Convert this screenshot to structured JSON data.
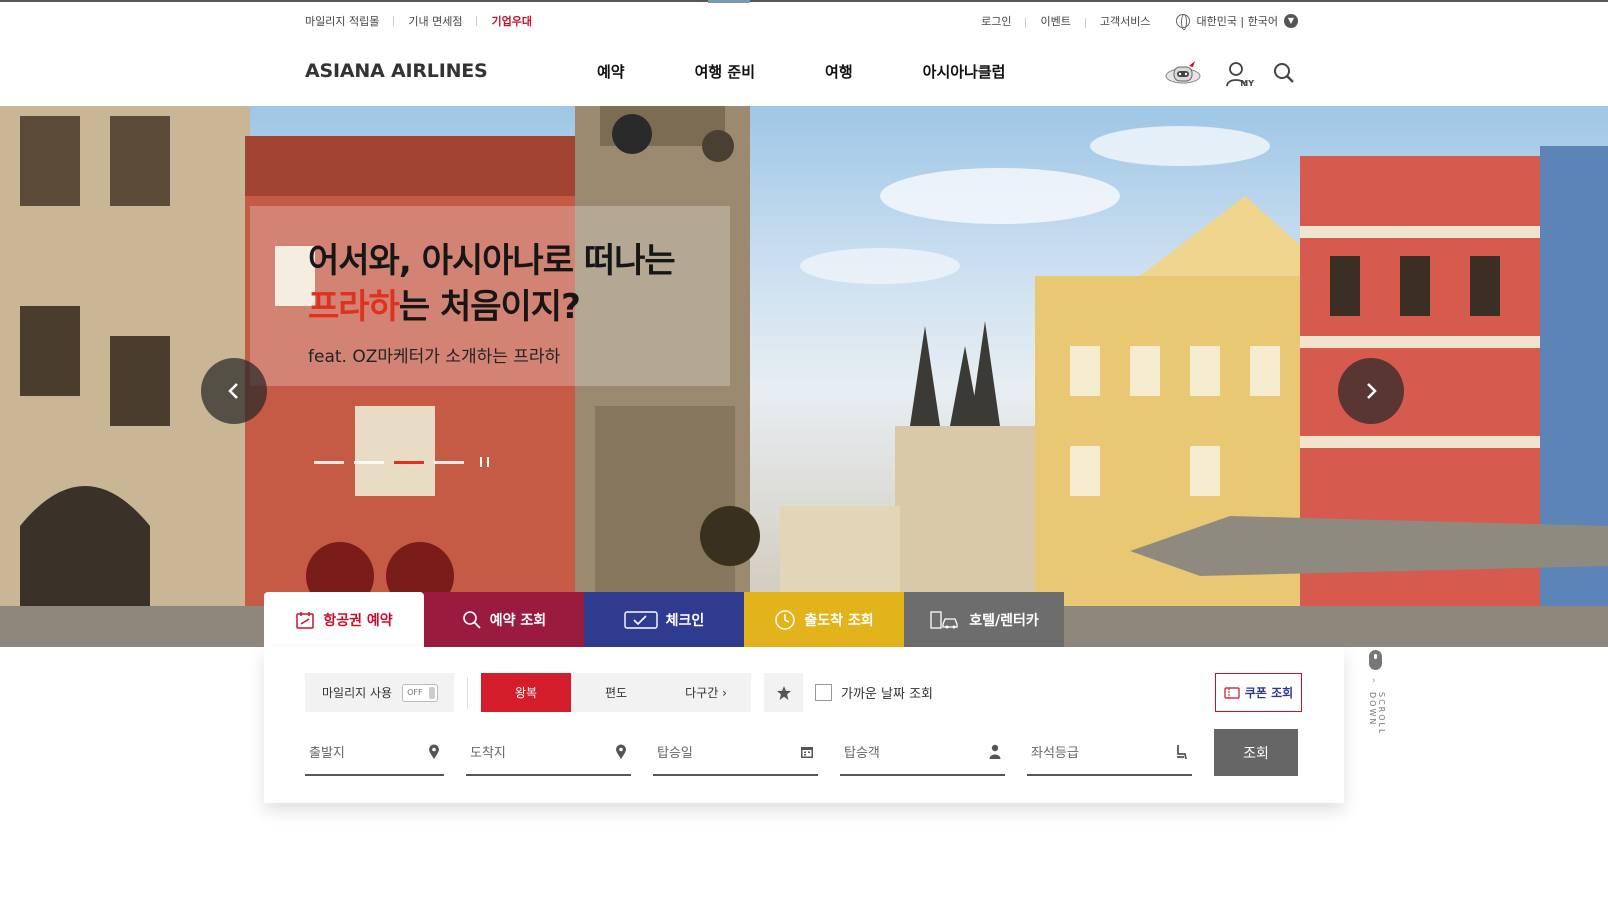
{
  "util": {
    "left": [
      "마일리지 적립몰",
      "기내 면세점",
      "기업우대"
    ],
    "right": [
      "로그인",
      "이벤트",
      "고객서비스"
    ],
    "lang": "대한민국 | 한국어"
  },
  "header": {
    "logo": "ASIANA AIRLINES",
    "nav": [
      "예약",
      "여행 준비",
      "여행",
      "아시아나클럽"
    ],
    "my_badge": "MY"
  },
  "hero": {
    "title_line1": "어서와, 아시아나로 떠나는",
    "title_highlight": "프라하",
    "title_line2_rest": "는 처음이지?",
    "subtitle": "feat. OZ마케터가 소개하는 프라하",
    "slide_count": 4,
    "active_slide": 3
  },
  "tabs": [
    "항공권 예약",
    "예약 조회",
    "체크인",
    "출도착 조회",
    "호텔/렌터카"
  ],
  "booking": {
    "mileage_label": "마일리지 사용",
    "toggle_state": "OFF",
    "trip_types": [
      "왕복",
      "편도",
      "다구간"
    ],
    "active_trip": "왕복",
    "nearby_dates": "가까운 날짜 조회",
    "coupon": "쿠폰 조회",
    "fields": {
      "origin": "출발지",
      "destination": "도착지",
      "date": "탑승일",
      "passengers": "탑승객",
      "cabin": "좌석등급"
    },
    "search": "조회"
  },
  "scroll_hint": "SCROLL DOWN",
  "colors": {
    "brand_red": "#c8102e",
    "tab_reservation": "#9b1b3f",
    "tab_checkin": "#2f3b8f",
    "tab_status": "#e3b31c",
    "tab_hotel": "#6d6d6d"
  }
}
